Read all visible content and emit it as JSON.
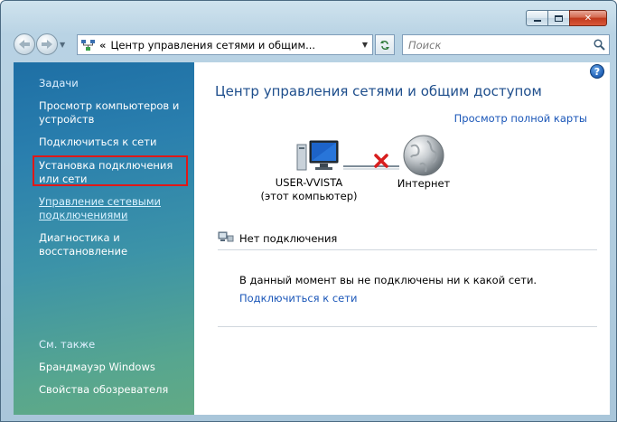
{
  "window": {
    "caption": {
      "minimize": "",
      "maximize": "",
      "close": "✕"
    }
  },
  "address_bar": {
    "path": "Центр управления сетями и общим..."
  },
  "search": {
    "placeholder": "Поиск"
  },
  "sidebar": {
    "tasks_heading": "Задачи",
    "items": [
      {
        "label": "Просмотр компьютеров и устройств"
      },
      {
        "label": "Подключиться к сети"
      },
      {
        "label": "Установка подключения или сети"
      },
      {
        "label": "Управление сетевыми подключениями"
      },
      {
        "label": "Диагностика и восстановление"
      }
    ],
    "see_also_heading": "См. также",
    "see_also": [
      {
        "label": "Брандмауэр Windows"
      },
      {
        "label": "Свойства обозревателя"
      }
    ]
  },
  "main": {
    "title": "Центр управления сетями и общим доступом",
    "full_map_link": "Просмотр полной карты",
    "computer_name": "USER-VVISTA",
    "computer_caption": "(этот компьютер)",
    "internet_label": "Интернет",
    "status_heading": "Нет подключения",
    "status_message": "В данный момент вы не подключены ни к какой сети.",
    "connect_link": "Подключиться к сети"
  },
  "colors": {
    "title_blue": "#1e4e8c",
    "link_blue": "#1a56b8",
    "highlight_red": "#e01818",
    "sidebar_top": "#1e6fa5",
    "sidebar_bottom": "#62aa84"
  }
}
